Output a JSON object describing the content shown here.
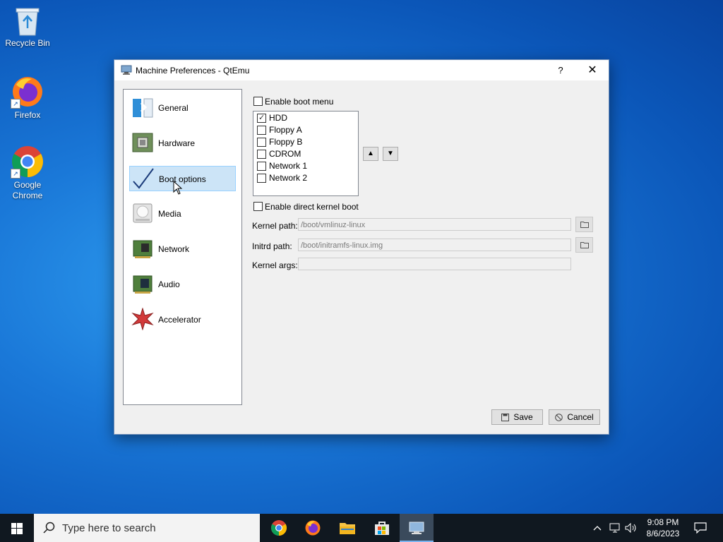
{
  "desktop": {
    "icons": [
      {
        "label": "Recycle Bin"
      },
      {
        "label": "Firefox"
      },
      {
        "label": "Google Chrome"
      }
    ]
  },
  "dialog": {
    "title": "Machine Preferences - QtEmu",
    "help_label": "?",
    "close_label": "✕",
    "nav": [
      {
        "label": "General"
      },
      {
        "label": "Hardware"
      },
      {
        "label": "Boot options"
      },
      {
        "label": "Media"
      },
      {
        "label": "Network"
      },
      {
        "label": "Audio"
      },
      {
        "label": "Accelerator"
      }
    ],
    "selected_nav": "Boot options",
    "boot": {
      "enable_boot_menu_label": "Enable boot menu",
      "enable_boot_menu_checked": false,
      "devices": [
        {
          "label": "HDD",
          "checked": true
        },
        {
          "label": "Floppy A",
          "checked": false
        },
        {
          "label": "Floppy B",
          "checked": false
        },
        {
          "label": "CDROM",
          "checked": false
        },
        {
          "label": "Network 1",
          "checked": false
        },
        {
          "label": "Network 2",
          "checked": false
        }
      ],
      "enable_kernel_boot_label": "Enable direct kernel boot",
      "enable_kernel_boot_checked": false,
      "kernel_path_label": "Kernel path:",
      "kernel_path_placeholder": "/boot/vmlinuz-linux",
      "initrd_path_label": "Initrd path:",
      "initrd_path_placeholder": "/boot/initramfs-linux.img",
      "kernel_args_label": "Kernel args:",
      "kernel_args_value": ""
    },
    "save_label": "Save",
    "cancel_label": "Cancel"
  },
  "taskbar": {
    "search_placeholder": "Type here to search",
    "time": "9:08 PM",
    "date": "8/6/2023"
  }
}
